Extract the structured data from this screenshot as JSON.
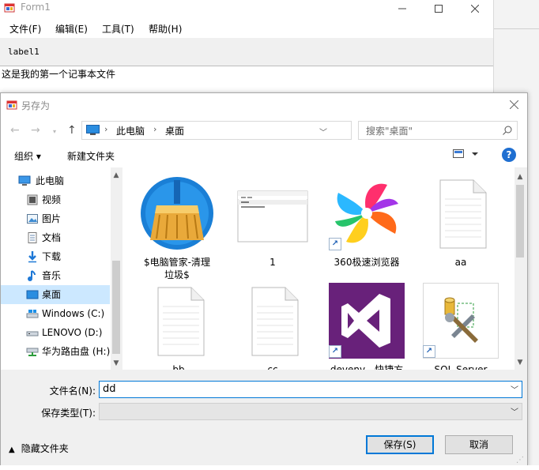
{
  "form1": {
    "title": "Form1",
    "menu": [
      "文件(F)",
      "编辑(E)",
      "工具(T)",
      "帮助(H)"
    ],
    "label": "label1",
    "text": "这是我的第一个记事本文件"
  },
  "dialog": {
    "title": "另存为",
    "address": [
      "此电脑",
      "桌面"
    ],
    "search_placeholder": "搜索\"桌面\"",
    "toolbar": {
      "organize": "组织 ▾",
      "new_folder": "新建文件夹"
    },
    "nav": [
      {
        "label": "此电脑",
        "icon": "computer-icon"
      },
      {
        "label": "视频",
        "icon": "video-folder-icon"
      },
      {
        "label": "图片",
        "icon": "pictures-folder-icon"
      },
      {
        "label": "文档",
        "icon": "documents-folder-icon"
      },
      {
        "label": "下载",
        "icon": "downloads-folder-icon"
      },
      {
        "label": "音乐",
        "icon": "music-folder-icon"
      },
      {
        "label": "桌面",
        "icon": "desktop-folder-icon",
        "selected": true
      },
      {
        "label": "Windows (C:)",
        "icon": "drive-icon"
      },
      {
        "label": "LENOVO (D:)",
        "icon": "drive-icon"
      },
      {
        "label": "华为路由盘 (H:)",
        "icon": "network-drive-icon"
      }
    ],
    "files": [
      {
        "name": "$电脑管家-清理\n垃圾$",
        "type": "broom"
      },
      {
        "name": "1",
        "type": "window"
      },
      {
        "name": "360极速浏览器",
        "type": "pinwheel",
        "shortcut": true
      },
      {
        "name": "aa",
        "type": "doc"
      },
      {
        "name": "bb",
        "type": "doc"
      },
      {
        "name": "cc",
        "type": "doc"
      },
      {
        "name": "devenv - 快捷方",
        "type": "vs",
        "shortcut": true
      },
      {
        "name": "SQL Server",
        "type": "sql",
        "shortcut": true
      }
    ],
    "filename_label": "文件名(N):",
    "filename_value": "dd",
    "filetype_label": "保存类型(T):",
    "filetype_value": "",
    "hide_folders": "隐藏文件夹",
    "save_button": "保存(S)",
    "cancel_button": "取消"
  },
  "colors": {
    "accent": "#0078d7",
    "selection": "#cce8ff",
    "vs_purple": "#68217a"
  }
}
